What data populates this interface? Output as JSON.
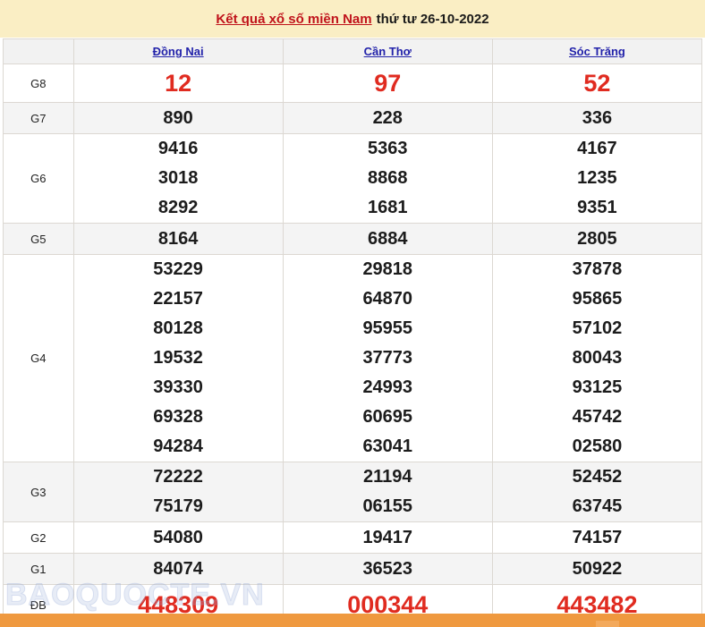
{
  "banner": {
    "title_link": "Kết quả xổ số miền Nam",
    "date_text": "thứ tư 26-10-2022"
  },
  "table": {
    "label_column_header": "",
    "columns": [
      "Đồng Nai",
      "Cần Thơ",
      "Sóc Trăng"
    ],
    "rows": [
      {
        "label": "G8",
        "style": "g8",
        "values": [
          [
            "12"
          ],
          [
            "97"
          ],
          [
            "52"
          ]
        ]
      },
      {
        "label": "G7",
        "style": "normal",
        "values": [
          [
            "890"
          ],
          [
            "228"
          ],
          [
            "336"
          ]
        ]
      },
      {
        "label": "G6",
        "style": "normal",
        "values": [
          [
            "9416",
            "3018",
            "8292"
          ],
          [
            "5363",
            "8868",
            "1681"
          ],
          [
            "4167",
            "1235",
            "9351"
          ]
        ]
      },
      {
        "label": "G5",
        "style": "normal",
        "values": [
          [
            "8164"
          ],
          [
            "6884"
          ],
          [
            "2805"
          ]
        ]
      },
      {
        "label": "G4",
        "style": "normal",
        "values": [
          [
            "53229",
            "22157",
            "80128",
            "19532",
            "39330",
            "69328",
            "94284"
          ],
          [
            "29818",
            "64870",
            "95955",
            "37773",
            "24993",
            "60695",
            "63041"
          ],
          [
            "37878",
            "95865",
            "57102",
            "80043",
            "93125",
            "45742",
            "02580"
          ]
        ]
      },
      {
        "label": "G3",
        "style": "normal",
        "values": [
          [
            "72222",
            "75179"
          ],
          [
            "21194",
            "06155"
          ],
          [
            "52452",
            "63745"
          ]
        ]
      },
      {
        "label": "G2",
        "style": "normal",
        "values": [
          [
            "54080"
          ],
          [
            "19417"
          ],
          [
            "74157"
          ]
        ]
      },
      {
        "label": "G1",
        "style": "normal",
        "values": [
          [
            "84074"
          ],
          [
            "36523"
          ],
          [
            "50922"
          ]
        ]
      },
      {
        "label": "ĐB",
        "style": "db",
        "values": [
          [
            "448309"
          ],
          [
            "000344"
          ],
          [
            "443482"
          ]
        ]
      }
    ]
  },
  "watermark": {
    "text": "BAOQUOCTE.VN"
  },
  "colors": {
    "banner_background": "#faeec4",
    "title_red": "#c0131b",
    "province_blue": "#2222aa",
    "highlight_red": "#e02b20",
    "row_stripe": "#f4f4f4",
    "bottom_bar": "#ef993f"
  }
}
